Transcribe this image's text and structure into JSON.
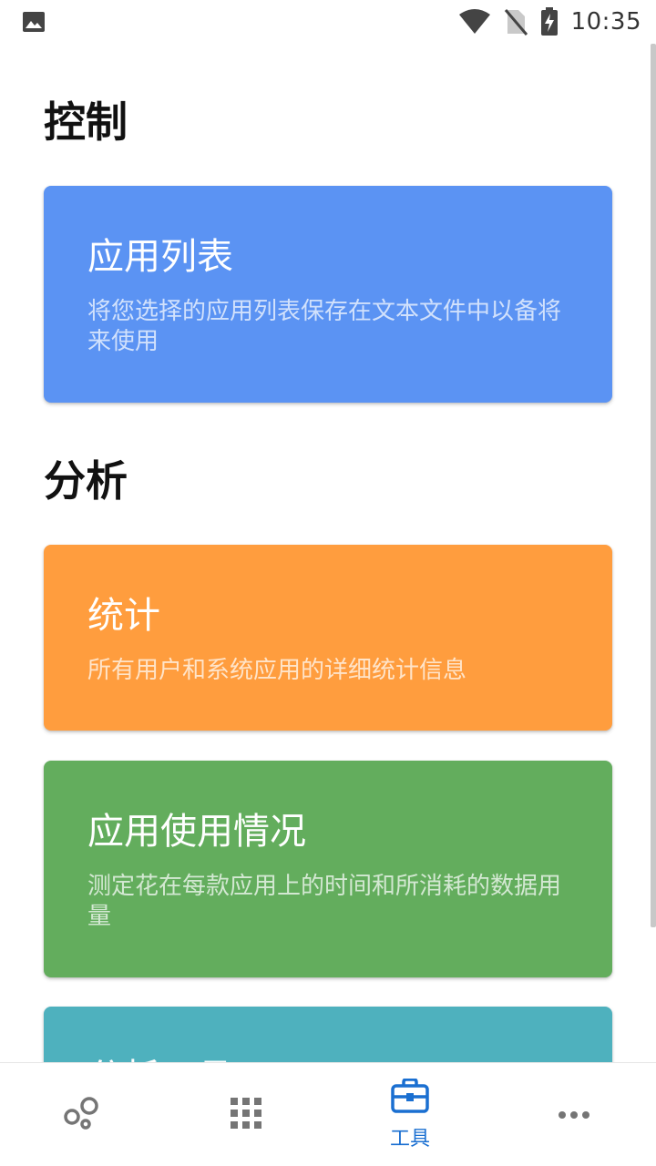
{
  "status_bar": {
    "time": "10:35",
    "icons": [
      "image-icon",
      "wifi-icon",
      "no-sim-icon",
      "battery-charging-icon"
    ]
  },
  "sections": [
    {
      "title": "控制",
      "cards": [
        {
          "title": "应用列表",
          "description": "将您选择的应用列表保存在文本文件中以备将来使用",
          "color": "#5b93f3"
        }
      ]
    },
    {
      "title": "分析",
      "cards": [
        {
          "title": "统计",
          "description": "所有用户和系统应用的详细统计信息",
          "color": "#ff9d3e"
        },
        {
          "title": "应用使用情况",
          "description": "测定花在每款应用上的时间和所消耗的数据用量",
          "color": "#63ad5d"
        },
        {
          "title": "分析工具",
          "description": "",
          "color": "#4eb1be"
        }
      ]
    }
  ],
  "bottom_nav": {
    "items": [
      {
        "icon": "bubbles-icon",
        "label": ""
      },
      {
        "icon": "grid-icon",
        "label": ""
      },
      {
        "icon": "toolbox-icon",
        "label": "工具",
        "active": true
      },
      {
        "icon": "more-icon",
        "label": ""
      }
    ],
    "active_color": "#1a6fd1",
    "inactive_color": "#757575"
  }
}
